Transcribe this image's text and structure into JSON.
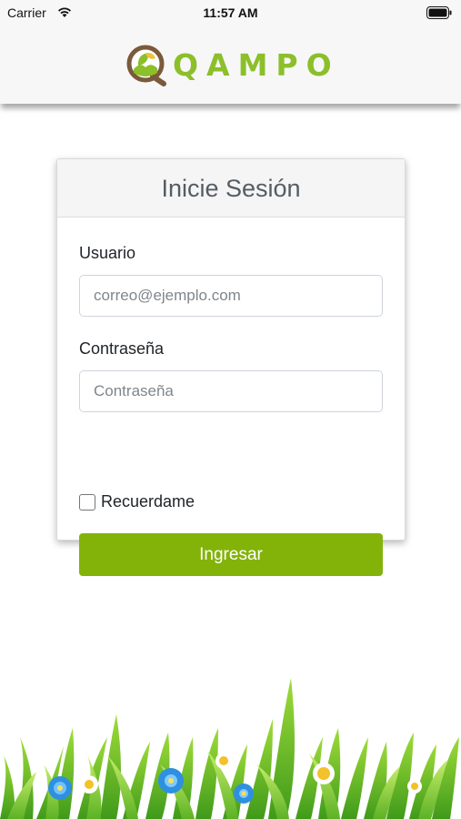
{
  "status_bar": {
    "carrier": "Carrier",
    "time": "11:57 AM"
  },
  "header": {
    "logo_text": "QAMPO",
    "brand_color": "#8cbf2a",
    "logo_icon": "qampo-leaf-icon"
  },
  "login": {
    "title": "Inicie Sesión",
    "username_label": "Usuario",
    "username_placeholder": "correo@ejemplo.com",
    "username_value": "",
    "password_label": "Contraseña",
    "password_placeholder": "Contraseña",
    "password_value": "",
    "remember_label": "Recuerdame",
    "remember_checked": false,
    "submit_label": "Ingresar",
    "submit_color": "#83b309"
  },
  "decoration": {
    "footer_image": "grass-flowers-illustration"
  }
}
